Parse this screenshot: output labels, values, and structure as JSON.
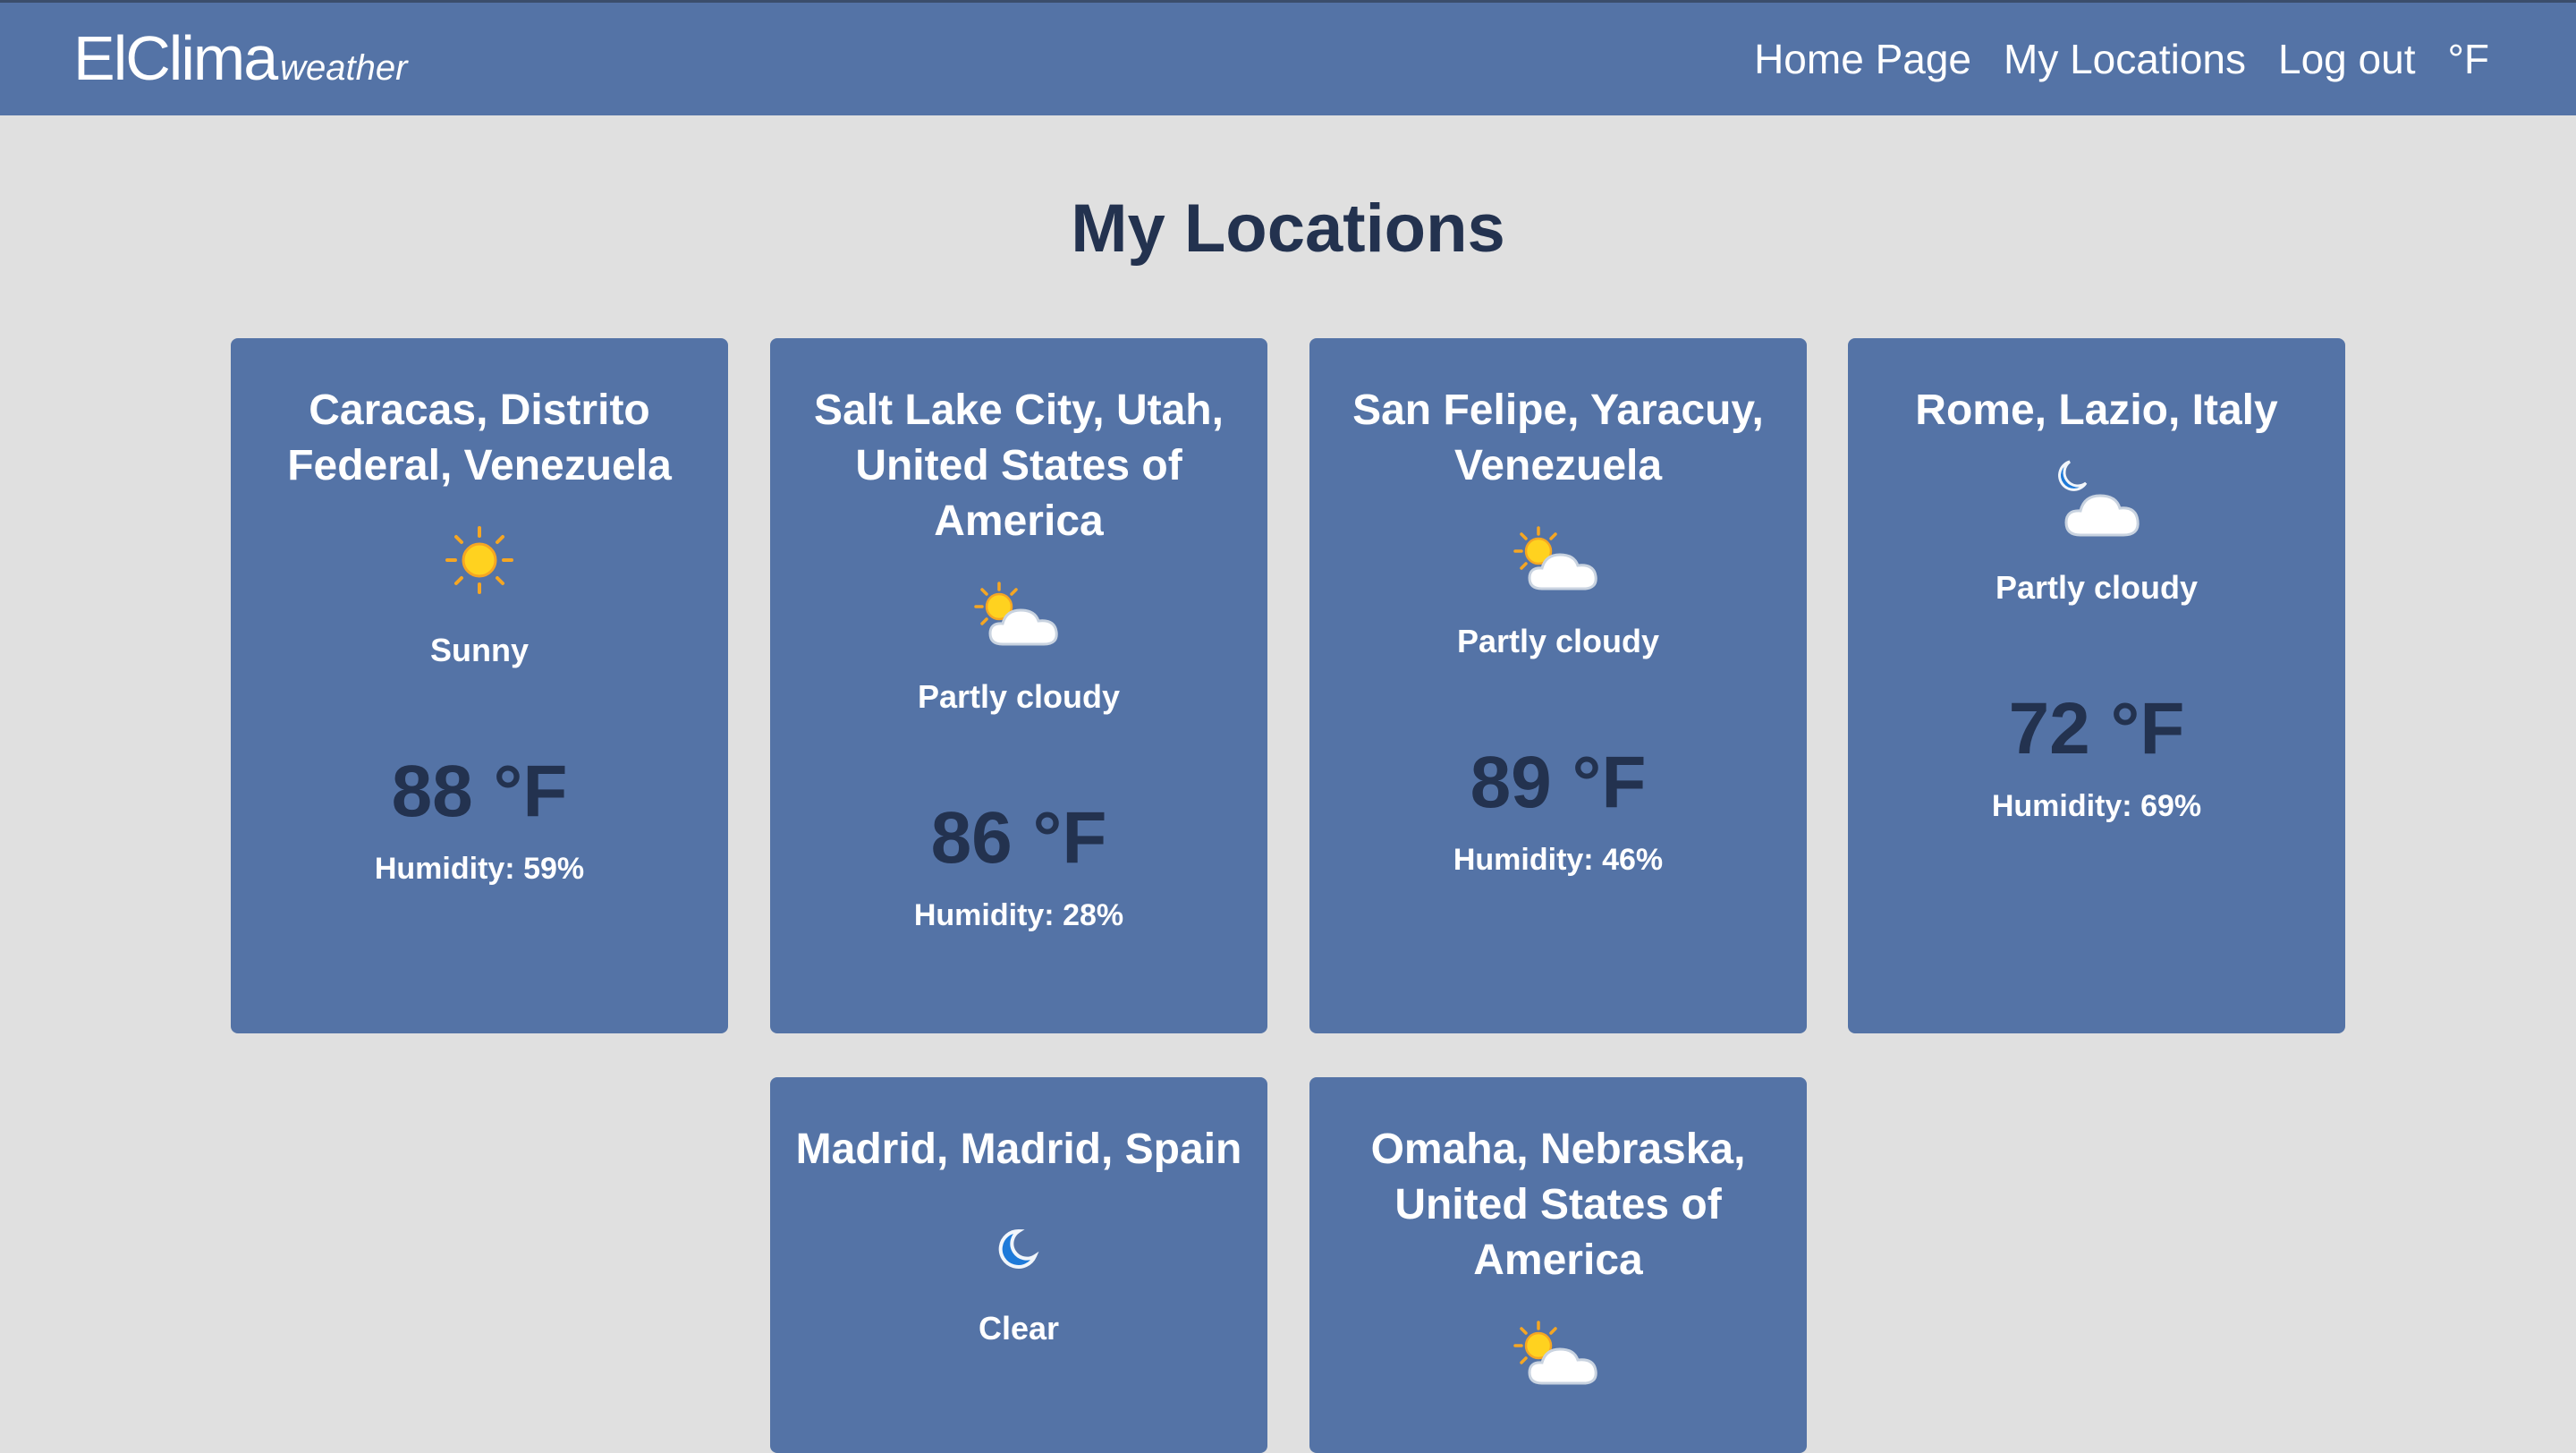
{
  "nav": {
    "brand_main": "ElClima",
    "brand_sub": "weather",
    "links": [
      "Home Page",
      "My Locations",
      "Log out",
      "°F"
    ]
  },
  "page": {
    "title": "My Locations"
  },
  "locations": [
    {
      "name": "Caracas, Distrito Federal, Venezuela",
      "icon": "sun-icon",
      "condition": "Sunny",
      "temp": "88 °F",
      "humidity": "Humidity: 59%"
    },
    {
      "name": "Salt Lake City, Utah, United States of America",
      "icon": "sun-cloud-icon",
      "condition": "Partly cloudy",
      "temp": "86 °F",
      "humidity": "Humidity: 28%"
    },
    {
      "name": "San Felipe, Yaracuy, Venezuela",
      "icon": "sun-cloud-icon",
      "condition": "Partly cloudy",
      "temp": "89 °F",
      "humidity": "Humidity: 46%"
    },
    {
      "name": "Rome, Lazio, Italy",
      "icon": "moon-cloud-icon",
      "condition": "Partly cloudy",
      "temp": "72 °F",
      "humidity": "Humidity: 69%"
    },
    {
      "name": "Madrid, Madrid, Spain",
      "icon": "moon-icon",
      "condition": "Clear"
    },
    {
      "name": "Omaha, Nebraska, United States of America",
      "icon": "sun-cloud-icon"
    }
  ],
  "colors": {
    "navbar": "#5473a6",
    "card": "#5473a6",
    "background": "#e0e0e0",
    "title_text": "#23324f"
  }
}
